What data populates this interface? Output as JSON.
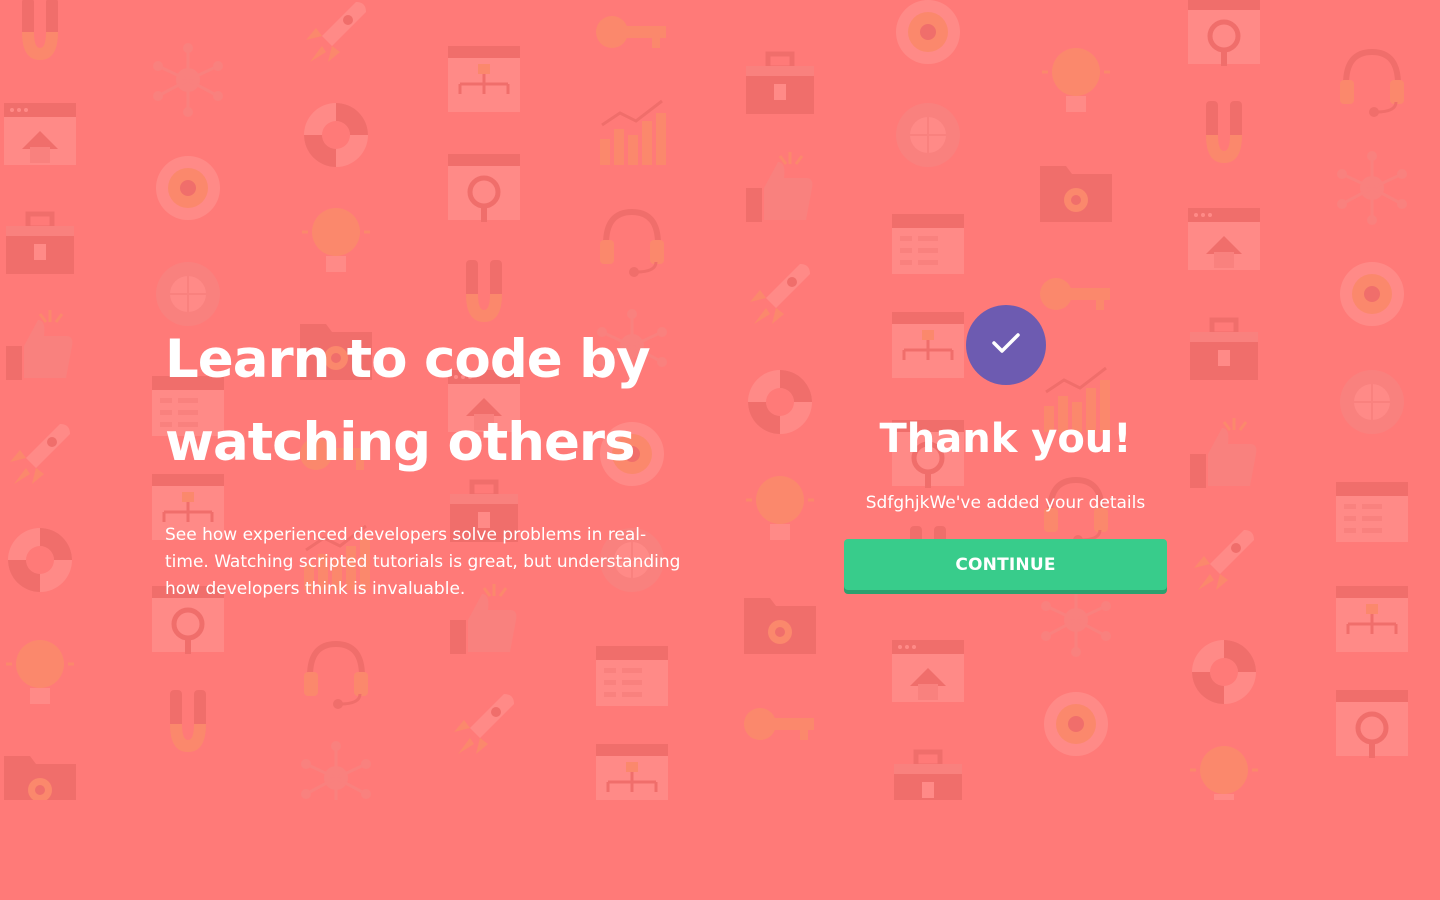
{
  "hero": {
    "title_line1": "Learn to code by",
    "title_line2": "watching others",
    "subtitle": "See how experienced developers solve problems in real-time. Watching scripted tutorials is great, but understanding how developers think is invaluable."
  },
  "confirmation": {
    "icon": "check-icon",
    "title": "Thank you!",
    "message": "SdfghjkWe've added your details",
    "button_label": "CONTINUE"
  },
  "colors": {
    "background": "#ff7a78",
    "badge": "#6d5bb1",
    "button": "#38cc8b",
    "text": "#ffffff"
  }
}
